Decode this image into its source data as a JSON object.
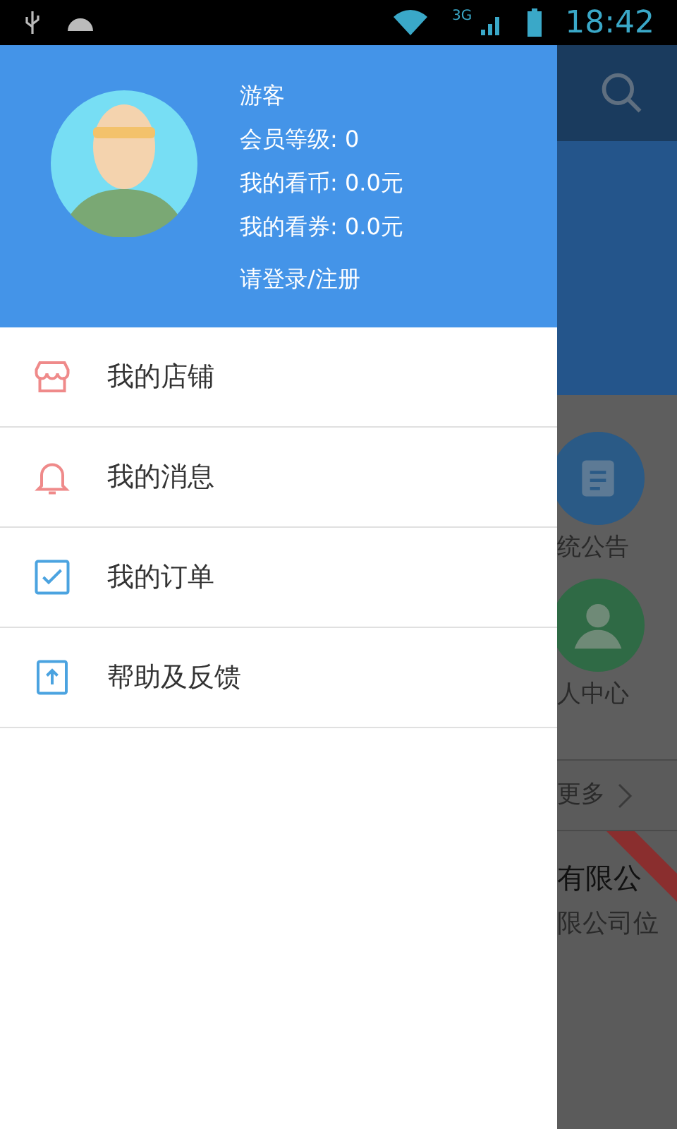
{
  "status_bar": {
    "network": "3G",
    "time": "18:42"
  },
  "profile": {
    "name": "游客",
    "lines": [
      "会员等级: 0",
      "我的看币: 0.0元",
      "我的看券: 0.0元"
    ],
    "login": "请登录/注册"
  },
  "menu": [
    {
      "kind": "shop",
      "label": "我的店铺"
    },
    {
      "kind": "bell",
      "label": "我的消息"
    },
    {
      "kind": "check",
      "label": "我的订单"
    },
    {
      "kind": "upload",
      "label": "帮助及反馈"
    }
  ],
  "background": {
    "shortcuts": [
      {
        "kind": "notice",
        "label": "统公告"
      },
      {
        "kind": "person",
        "label": "人中心"
      }
    ],
    "more": "更多",
    "item_title": "有限公",
    "item_subtitle": "限公司位"
  }
}
